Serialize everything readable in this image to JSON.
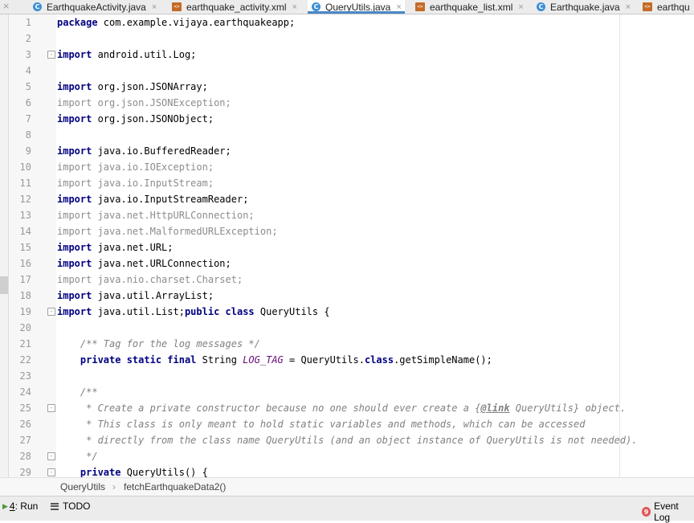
{
  "tabs": [
    {
      "label": "EarthquakeActivity.java",
      "icon": "java-class-icon",
      "active": false
    },
    {
      "label": "earthquake_activity.xml",
      "icon": "xml-file-icon",
      "active": false
    },
    {
      "label": "QueryUtils.java",
      "icon": "java-class-icon",
      "active": true
    },
    {
      "label": "earthquake_list.xml",
      "icon": "xml-file-icon",
      "active": false
    },
    {
      "label": "Earthquake.java",
      "icon": "java-class-icon",
      "active": false
    },
    {
      "label": "earthqu",
      "icon": "xml-file-icon",
      "active": false
    }
  ],
  "code": {
    "line_numbers": [
      "1",
      "2",
      "3",
      "4",
      "5",
      "6",
      "7",
      "8",
      "9",
      "10",
      "11",
      "12",
      "13",
      "14",
      "15",
      "16",
      "17",
      "18",
      "19",
      "20",
      "21",
      "22",
      "23",
      "24",
      "25",
      "26",
      "27",
      "28",
      "29"
    ],
    "l1": {
      "kw": "package",
      "rest": " com.example.vijaya.earthquakeapp;"
    },
    "l3": {
      "kw": "import",
      "rest": " android.util.Log;"
    },
    "l5": {
      "kw": "import",
      "rest": " org.json.JSONArray;"
    },
    "l6": {
      "kw": "import",
      "rest": " org.json.JSONException;"
    },
    "l7": {
      "kw": "import",
      "rest": " org.json.JSONObject;"
    },
    "l9": {
      "kw": "import",
      "rest": " java.io.BufferedReader;"
    },
    "l10": {
      "kw": "import",
      "rest": " java.io.IOException;"
    },
    "l11": {
      "kw": "import",
      "rest": " java.io.InputStream;"
    },
    "l12": {
      "kw": "import",
      "rest": " java.io.InputStreamReader;"
    },
    "l13": {
      "kw": "import",
      "rest": " java.net.HttpURLConnection;"
    },
    "l14": {
      "kw": "import",
      "rest": " java.net.MalformedURLException;"
    },
    "l15": {
      "kw": "import",
      "rest": " java.net.URL;"
    },
    "l16": {
      "kw": "import",
      "rest": " java.net.URLConnection;"
    },
    "l17": {
      "kw": "import",
      "rest": " java.nio.charset.Charset;"
    },
    "l18": {
      "kw": "import",
      "rest": " java.util.ArrayList;"
    },
    "l19": {
      "kw": "import",
      "mid": " java.util.List;",
      "kw2": "public class",
      "rest": " QueryUtils {"
    },
    "l21": {
      "comment": "    /** Tag for the log messages */"
    },
    "l22": {
      "indent": "    ",
      "kw": "private static final",
      "type": " String ",
      "field": "LOG_TAG",
      "mid": " = QueryUtils.",
      "kw2": "class",
      "rest": ".getSimpleName();"
    },
    "l24": {
      "comment": "    /**"
    },
    "l25": {
      "pre": "     * Create a private constructor because no one should ever create a {",
      "tag": "@link",
      "ref": " QueryUtils",
      "post": "} object."
    },
    "l26": {
      "comment": "     * This class is only meant to hold static variables and methods, which can be accessed"
    },
    "l27": {
      "comment": "     * directly from the class name QueryUtils (and an object instance of QueryUtils is not needed)."
    },
    "l28": {
      "comment": "     */"
    },
    "l29": {
      "indent": "    ",
      "kw": "private",
      "rest": " QueryUtils() {"
    }
  },
  "breadcrumb": {
    "class_name": "QueryUtils",
    "separator": "›",
    "method": "fetchEarthquakeData2()"
  },
  "toolbar": {
    "run": {
      "number": "4",
      "label": ": Run"
    },
    "todo": {
      "label": "TODO"
    },
    "event_log": {
      "label": "Event Log"
    }
  }
}
